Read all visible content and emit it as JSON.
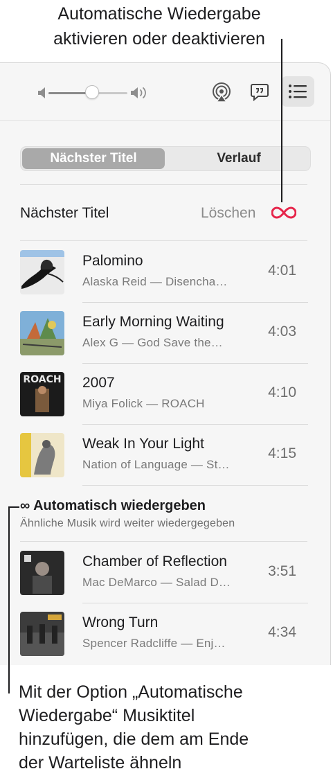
{
  "callout_top": {
    "line1": "Automatische Wiedergabe",
    "line2": "aktivieren oder deaktivieren"
  },
  "toolbar": {
    "volume_level": 0.55,
    "icons": [
      "volume-low-icon",
      "volume-high-icon",
      "airplay-icon",
      "lyrics-icon",
      "queue-list-icon"
    ]
  },
  "segment": {
    "active": "Nächster Titel",
    "inactive": "Verlauf"
  },
  "up_next": {
    "title": "Nächster Titel",
    "clear_label": "Löschen",
    "autoplay_icon": "infinity-icon",
    "accent": "#e6254a"
  },
  "queue": [
    {
      "title": "Palomino",
      "subtitle": "Alaska Reid — Disencha…",
      "duration": "4:01"
    },
    {
      "title": "Early Morning Waiting",
      "subtitle": "Alex G — God Save the…",
      "duration": "4:03"
    },
    {
      "title": "2007",
      "subtitle": "Miya Folick — ROACH",
      "duration": "4:10",
      "art_text": "ROACH"
    },
    {
      "title": "Weak In Your Light",
      "subtitle": "Nation of Language — St…",
      "duration": "4:15"
    }
  ],
  "autoplay": {
    "heading": "∞ Automatisch wiedergeben",
    "subtitle": "Ähnliche Musik wird weiter wiedergegeben",
    "tracks": [
      {
        "title": "Chamber of Reflection",
        "subtitle": "Mac DeMarco — Salad D…",
        "duration": "3:51"
      },
      {
        "title": "Wrong Turn",
        "subtitle": "Spencer Radcliffe — Enj…",
        "duration": "4:34"
      }
    ]
  },
  "callout_bottom": {
    "line1": "Mit der Option „Automatische",
    "line2": "Wiedergabe“ Musiktitel",
    "line3": "hinzufügen, die dem am Ende",
    "line4": "der Warteliste ähneln"
  }
}
